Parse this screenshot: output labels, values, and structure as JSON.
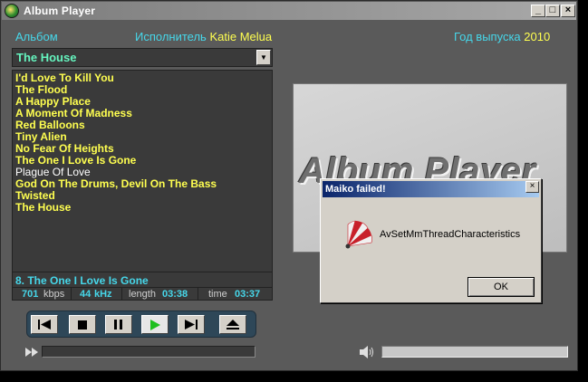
{
  "window": {
    "title": "Album Player",
    "controls": {
      "minimize": "_",
      "maximize": "□",
      "close": "×"
    }
  },
  "header": {
    "album_label": "Альбом",
    "artist_label": "Исполнитель",
    "artist_value": "Katie Melua",
    "year_label": "Год выпуска",
    "year_value": "2010"
  },
  "album_select": {
    "value": "The House",
    "arrow": "▼"
  },
  "tracks": [
    "I'd Love To Kill You",
    "The Flood",
    "A Happy Place",
    "A Moment Of Madness",
    "Red Balloons",
    "Tiny Alien",
    "No Fear Of Heights",
    "The One I Love Is Gone",
    "Plague Of Love",
    "God On The Drums, Devil On The Bass",
    "Twisted",
    "The House"
  ],
  "now_playing": {
    "text": "8.  The One I Love Is Gone"
  },
  "track_info": {
    "bitrate": "701",
    "bitrate_unit": "kbps",
    "sample_rate": "44",
    "sample_rate_unit": "kHz",
    "length_label": "length",
    "length_value": "03:38",
    "time_label": "time",
    "time_value": "03:37"
  },
  "icons": {
    "prev": "prev-track-icon",
    "stop": "stop-icon",
    "pause": "pause-icon",
    "play": "play-icon",
    "next": "next-track-icon",
    "eject": "eject-icon",
    "seek": "fast-forward-icon",
    "volume": "speaker-icon"
  },
  "logo": {
    "text": "Album Player"
  },
  "dialog": {
    "title": "Maiko failed!",
    "close": "×",
    "message": "AvSetMmThreadCharacteristics",
    "ok_label": "OK"
  },
  "colors": {
    "label": "#46d7ea",
    "value": "#ffff50",
    "album": "#65f5bf",
    "play": "#1fbf1f",
    "dialog_title": "#0a246a"
  }
}
